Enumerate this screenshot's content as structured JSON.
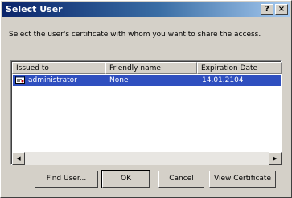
{
  "window": {
    "title": "Select User",
    "help_label": "?",
    "close_label": "×"
  },
  "prompt": "Select the user's certificate with whom you want to share the access.",
  "list": {
    "columns": [
      "Issued to",
      "Friendly name",
      "Expiration Date"
    ],
    "rows": [
      {
        "issued_to": "administrator",
        "friendly_name": "None",
        "expiration": "14.01.2104",
        "selected": true
      }
    ]
  },
  "buttons": {
    "find_user": "Find User...",
    "ok": "OK",
    "cancel": "Cancel",
    "view_certificate": "View Certificate"
  },
  "colors": {
    "selection": "#2f4fbf",
    "title_gradient_start": "#0a246a",
    "title_gradient_end": "#a6caf0",
    "face": "#d4d0c8"
  }
}
